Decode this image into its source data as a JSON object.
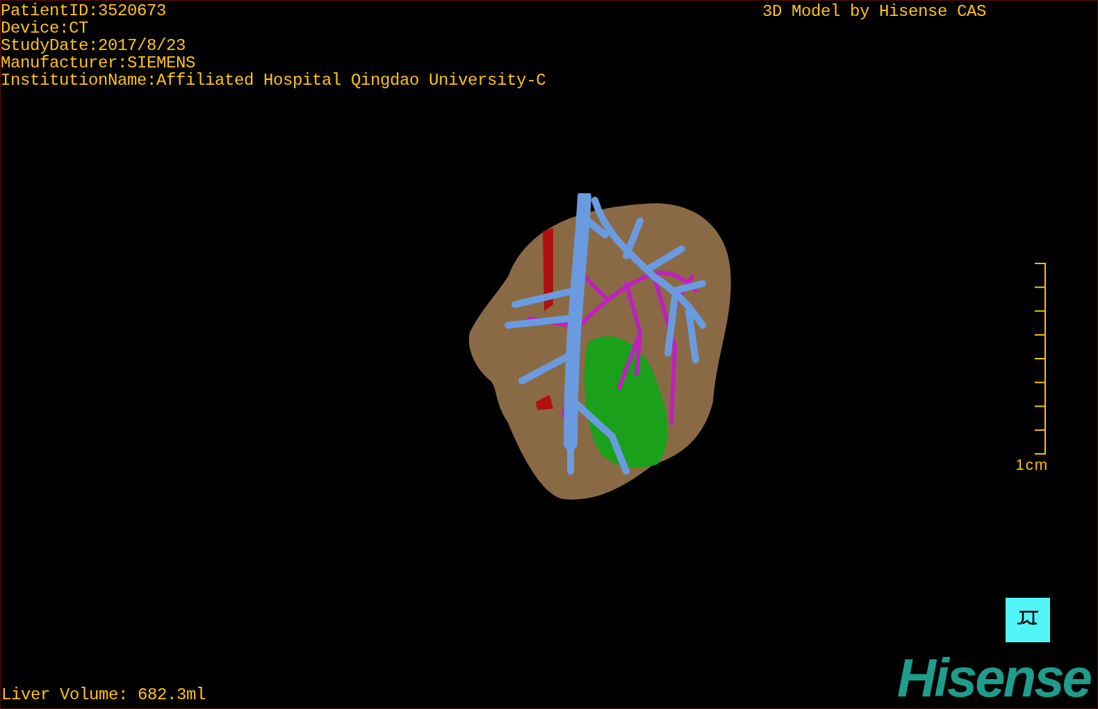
{
  "info_lines": [
    "PatientID:3520673",
    "Device:CT",
    "StudyDate:2017/8/23",
    "Manufacturer:SIEMENS",
    "InstitutionName:Affiliated Hospital Qingdao University-C"
  ],
  "title": "3D Model by Hisense CAS",
  "scale": {
    "label": "1cm"
  },
  "liver_volume": "Liver Volume: 682.3ml",
  "logo": "Hisense"
}
